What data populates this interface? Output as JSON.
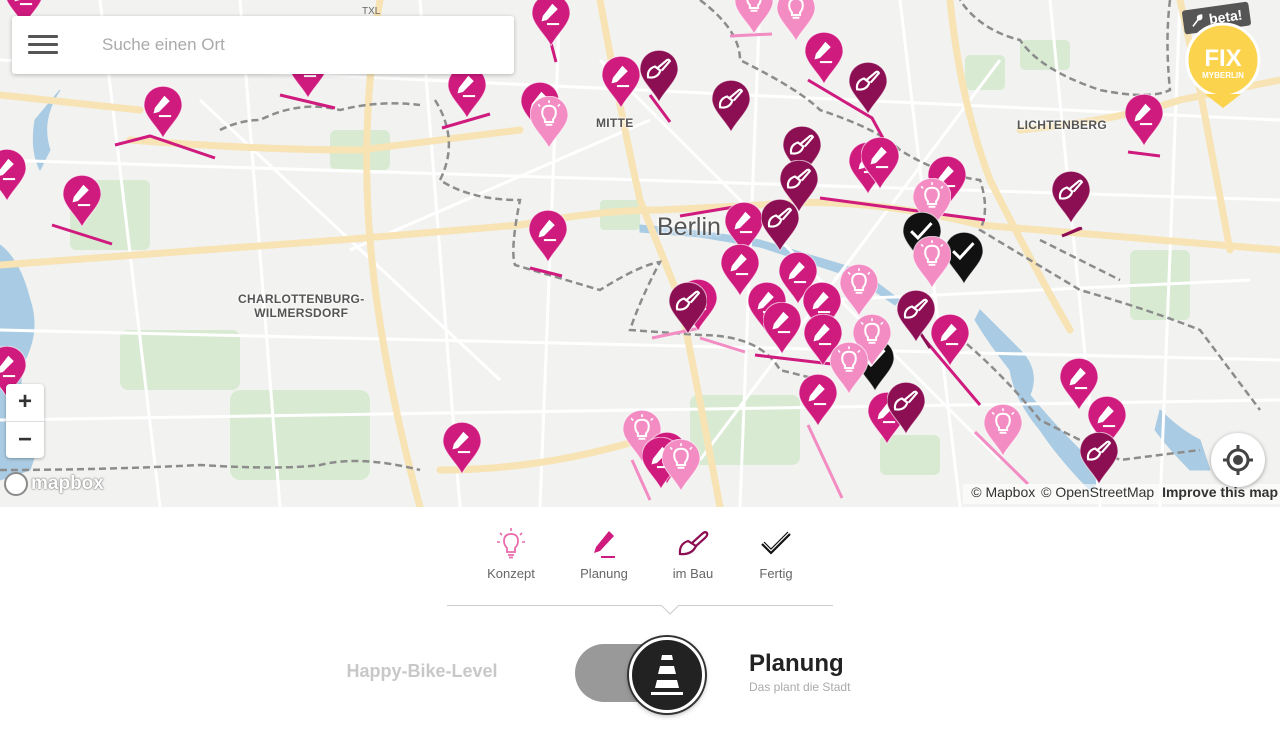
{
  "search": {
    "placeholder": "Suche einen Ort"
  },
  "map": {
    "districts": [
      {
        "name": "MITTE"
      },
      {
        "name": "LICHTENBERG"
      },
      {
        "name": "CHARLOTTENBURG-\nWILMERSDORF"
      }
    ],
    "city": "Berlin",
    "airport": "TXL",
    "zoom_in": "+",
    "zoom_out": "−",
    "mapbox_logo": "mapbox",
    "attribution": {
      "mapbox": "© Mapbox",
      "osm": "© OpenStreetMap",
      "improve": "Improve this map"
    },
    "colors": {
      "konzept": "#f28cc3",
      "planung": "#cf1a7e",
      "im_bau": "#8b0f52",
      "fertig": "#111111"
    },
    "markers": [
      {
        "type": "planung"
      },
      {
        "type": "planung"
      },
      {
        "type": "planung"
      },
      {
        "type": "konzept"
      },
      {
        "type": "konzept"
      },
      {
        "type": "planung"
      },
      {
        "type": "planung"
      },
      {
        "type": "im_bau"
      },
      {
        "type": "planung"
      },
      {
        "type": "im_bau"
      },
      {
        "type": "planung"
      },
      {
        "type": "konzept"
      },
      {
        "type": "planung"
      },
      {
        "type": "im_bau"
      },
      {
        "type": "im_bau"
      },
      {
        "type": "planung"
      },
      {
        "type": "planung"
      },
      {
        "type": "planung"
      },
      {
        "type": "planung"
      },
      {
        "type": "im_bau"
      },
      {
        "type": "im_bau"
      },
      {
        "type": "planung"
      },
      {
        "type": "planung"
      },
      {
        "type": "planung"
      },
      {
        "type": "konzept"
      },
      {
        "type": "planung"
      },
      {
        "type": "im_bau"
      },
      {
        "type": "fertig"
      },
      {
        "type": "fertig"
      },
      {
        "type": "konzept"
      },
      {
        "type": "planung"
      },
      {
        "type": "planung"
      },
      {
        "type": "konzept"
      },
      {
        "type": "planung"
      },
      {
        "type": "planung"
      },
      {
        "type": "im_bau"
      },
      {
        "type": "planung"
      },
      {
        "type": "planung"
      },
      {
        "type": "im_bau"
      },
      {
        "type": "fertig"
      },
      {
        "type": "planung"
      },
      {
        "type": "planung"
      },
      {
        "type": "konzept"
      },
      {
        "type": "konzept"
      },
      {
        "type": "planung"
      },
      {
        "type": "planung"
      },
      {
        "type": "konzept"
      },
      {
        "type": "planung"
      },
      {
        "type": "planung"
      },
      {
        "type": "im_bau"
      },
      {
        "type": "konzept"
      },
      {
        "type": "planung"
      },
      {
        "type": "planung"
      },
      {
        "type": "im_bau"
      },
      {
        "type": "planung"
      },
      {
        "type": "planung"
      },
      {
        "type": "konzept"
      }
    ]
  },
  "logo": {
    "main": "FIX",
    "sub": "MYBERLIN",
    "badge": "beta!"
  },
  "legend": [
    {
      "key": "konzept",
      "label": "Konzept",
      "icon": "lightbulb-icon"
    },
    {
      "key": "planung",
      "label": "Planung",
      "icon": "pencil-icon"
    },
    {
      "key": "im_bau",
      "label": "im Bau",
      "icon": "trowel-icon"
    },
    {
      "key": "fertig",
      "label": "Fertig",
      "icon": "checkmark-icon"
    }
  ],
  "toggle": {
    "left_label": "Happy-Bike-Level",
    "title": "Planung",
    "subtitle": "Das plant die Stadt",
    "icon": "traffic-cone-icon"
  }
}
